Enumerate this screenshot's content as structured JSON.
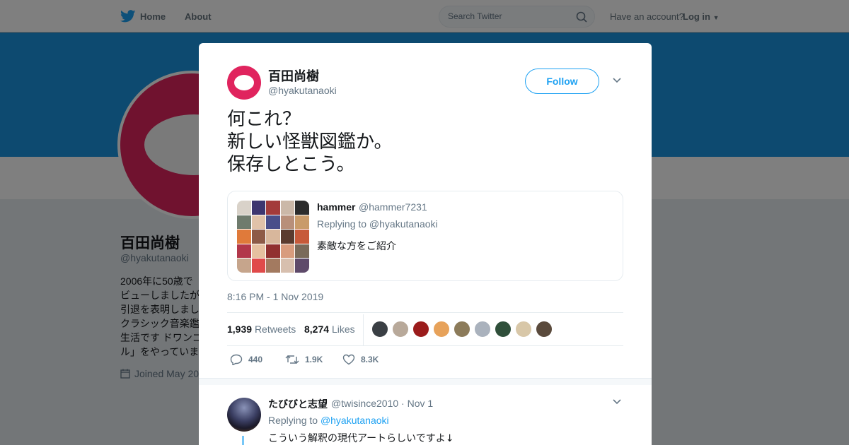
{
  "nav": {
    "home": "Home",
    "about": "About",
    "search_placeholder": "Search Twitter",
    "account_question": "Have an account?",
    "login": "Log in"
  },
  "profile": {
    "name": "百田尚樹",
    "handle": "@hyakutanaoki",
    "bio": "2006年に50歳で\nビューしましたが\n引退を表明しまし\nクラシック音楽鑑\n生活です ドワンゴ\nル」をやっていま",
    "joined": "Joined May 20"
  },
  "tweet": {
    "author_name": "百田尚樹",
    "author_handle": "@hyakutanaoki",
    "follow_label": "Follow",
    "text": "何これ？\n新しい怪獣図鑑か。\n保存しとこう。",
    "timestamp": "8:16 PM - 1 Nov 2019",
    "retweets_count": "1,939",
    "retweets_label": "Retweets",
    "likes_count": "8,274",
    "likes_label": "Likes",
    "actions": {
      "replies": "440",
      "retweets": "1.9K",
      "likes": "8.3K"
    }
  },
  "quoted": {
    "name": "hammer",
    "handle": "@hammer7231",
    "replying_to": "Replying to @hyakutanaoki",
    "text": "素敵な方をご紹介"
  },
  "likers": [
    "#3a3f44",
    "#b8a99a",
    "#9b1c1c",
    "#e7a25a",
    "#8c7b5a",
    "#aab2bd",
    "#2f4f3a",
    "#d8c7a8",
    "#5a4a3c"
  ],
  "reply": {
    "name": "たびびと志望",
    "handle": "@twisince2010 · Nov 1",
    "replying_prefix": "Replying to",
    "replying_link": "@hyakutanaoki",
    "text": "こういう解釈の現代アートらしいですよ↓"
  },
  "colors": {
    "accent": "#1da1f2",
    "brand_red": "#e0245e",
    "banner": "#1b95e0"
  }
}
